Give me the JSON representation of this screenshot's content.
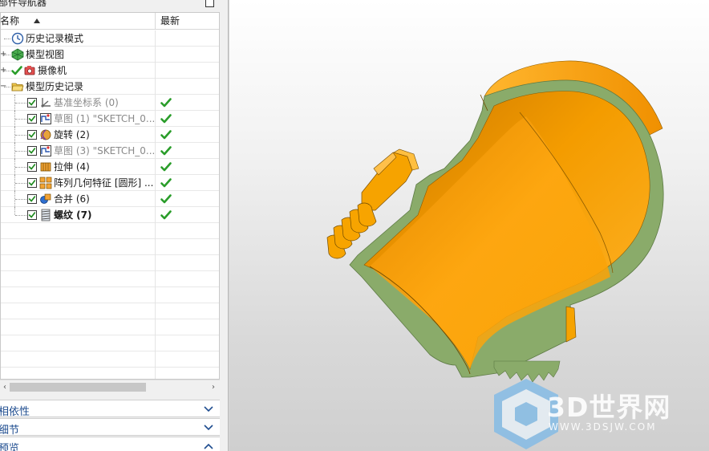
{
  "navigator": {
    "title": "部件导航器",
    "columns": {
      "name": "名称",
      "latest": "最新"
    },
    "rows": [
      {
        "label": "历史记录模式",
        "icon": "clock-icon",
        "style": "normal",
        "checked": null,
        "latest": false,
        "expander": ""
      },
      {
        "label": "模型视图",
        "icon": "model-views-icon",
        "style": "normal",
        "checked": null,
        "latest": false,
        "expander": "+"
      },
      {
        "label": "摄像机",
        "icon": "camera-icon",
        "style": "normal",
        "checked": null,
        "latest": false,
        "expander": "+"
      },
      {
        "label": "模型历史记录",
        "icon": "folder-open-icon",
        "style": "normal",
        "checked": null,
        "latest": false,
        "expander": "−"
      },
      {
        "label": "基准坐标系 (0)",
        "icon": "datum-csys-icon",
        "style": "gray",
        "checked": true,
        "latest": true,
        "expander": ""
      },
      {
        "label": "草图 (1) \"SKETCH_0...",
        "icon": "sketch-icon",
        "style": "gray",
        "checked": true,
        "latest": true,
        "expander": ""
      },
      {
        "label": "旋转 (2)",
        "icon": "revolve-icon",
        "style": "normal",
        "checked": true,
        "latest": true,
        "expander": ""
      },
      {
        "label": "草图 (3) \"SKETCH_0...",
        "icon": "sketch-icon",
        "style": "gray",
        "checked": true,
        "latest": true,
        "expander": ""
      },
      {
        "label": "拉伸 (4)",
        "icon": "extrude-icon",
        "style": "normal",
        "checked": true,
        "latest": true,
        "expander": ""
      },
      {
        "label": "阵列几何特征 [圆形] ...",
        "icon": "pattern-geometry-icon",
        "style": "normal",
        "checked": true,
        "latest": true,
        "expander": ""
      },
      {
        "label": "合并 (6)",
        "icon": "unite-icon",
        "style": "normal",
        "checked": true,
        "latest": true,
        "expander": ""
      },
      {
        "label": "螺纹 (7)",
        "icon": "thread-icon",
        "style": "bold",
        "checked": true,
        "latest": true,
        "expander": ""
      }
    ],
    "empty_rows": 10
  },
  "panels": [
    {
      "label": "相依性",
      "state": "collapsed"
    },
    {
      "label": "细节",
      "state": "collapsed"
    },
    {
      "label": "预览",
      "state": "expanded"
    }
  ],
  "viewport": {
    "model_colors": {
      "body": "#f6a300",
      "section": "#8aab6a",
      "edge": "#6e4a00"
    }
  },
  "watermark": {
    "text": "3D世界网",
    "url": "WWW.3DSJW.COM"
  }
}
